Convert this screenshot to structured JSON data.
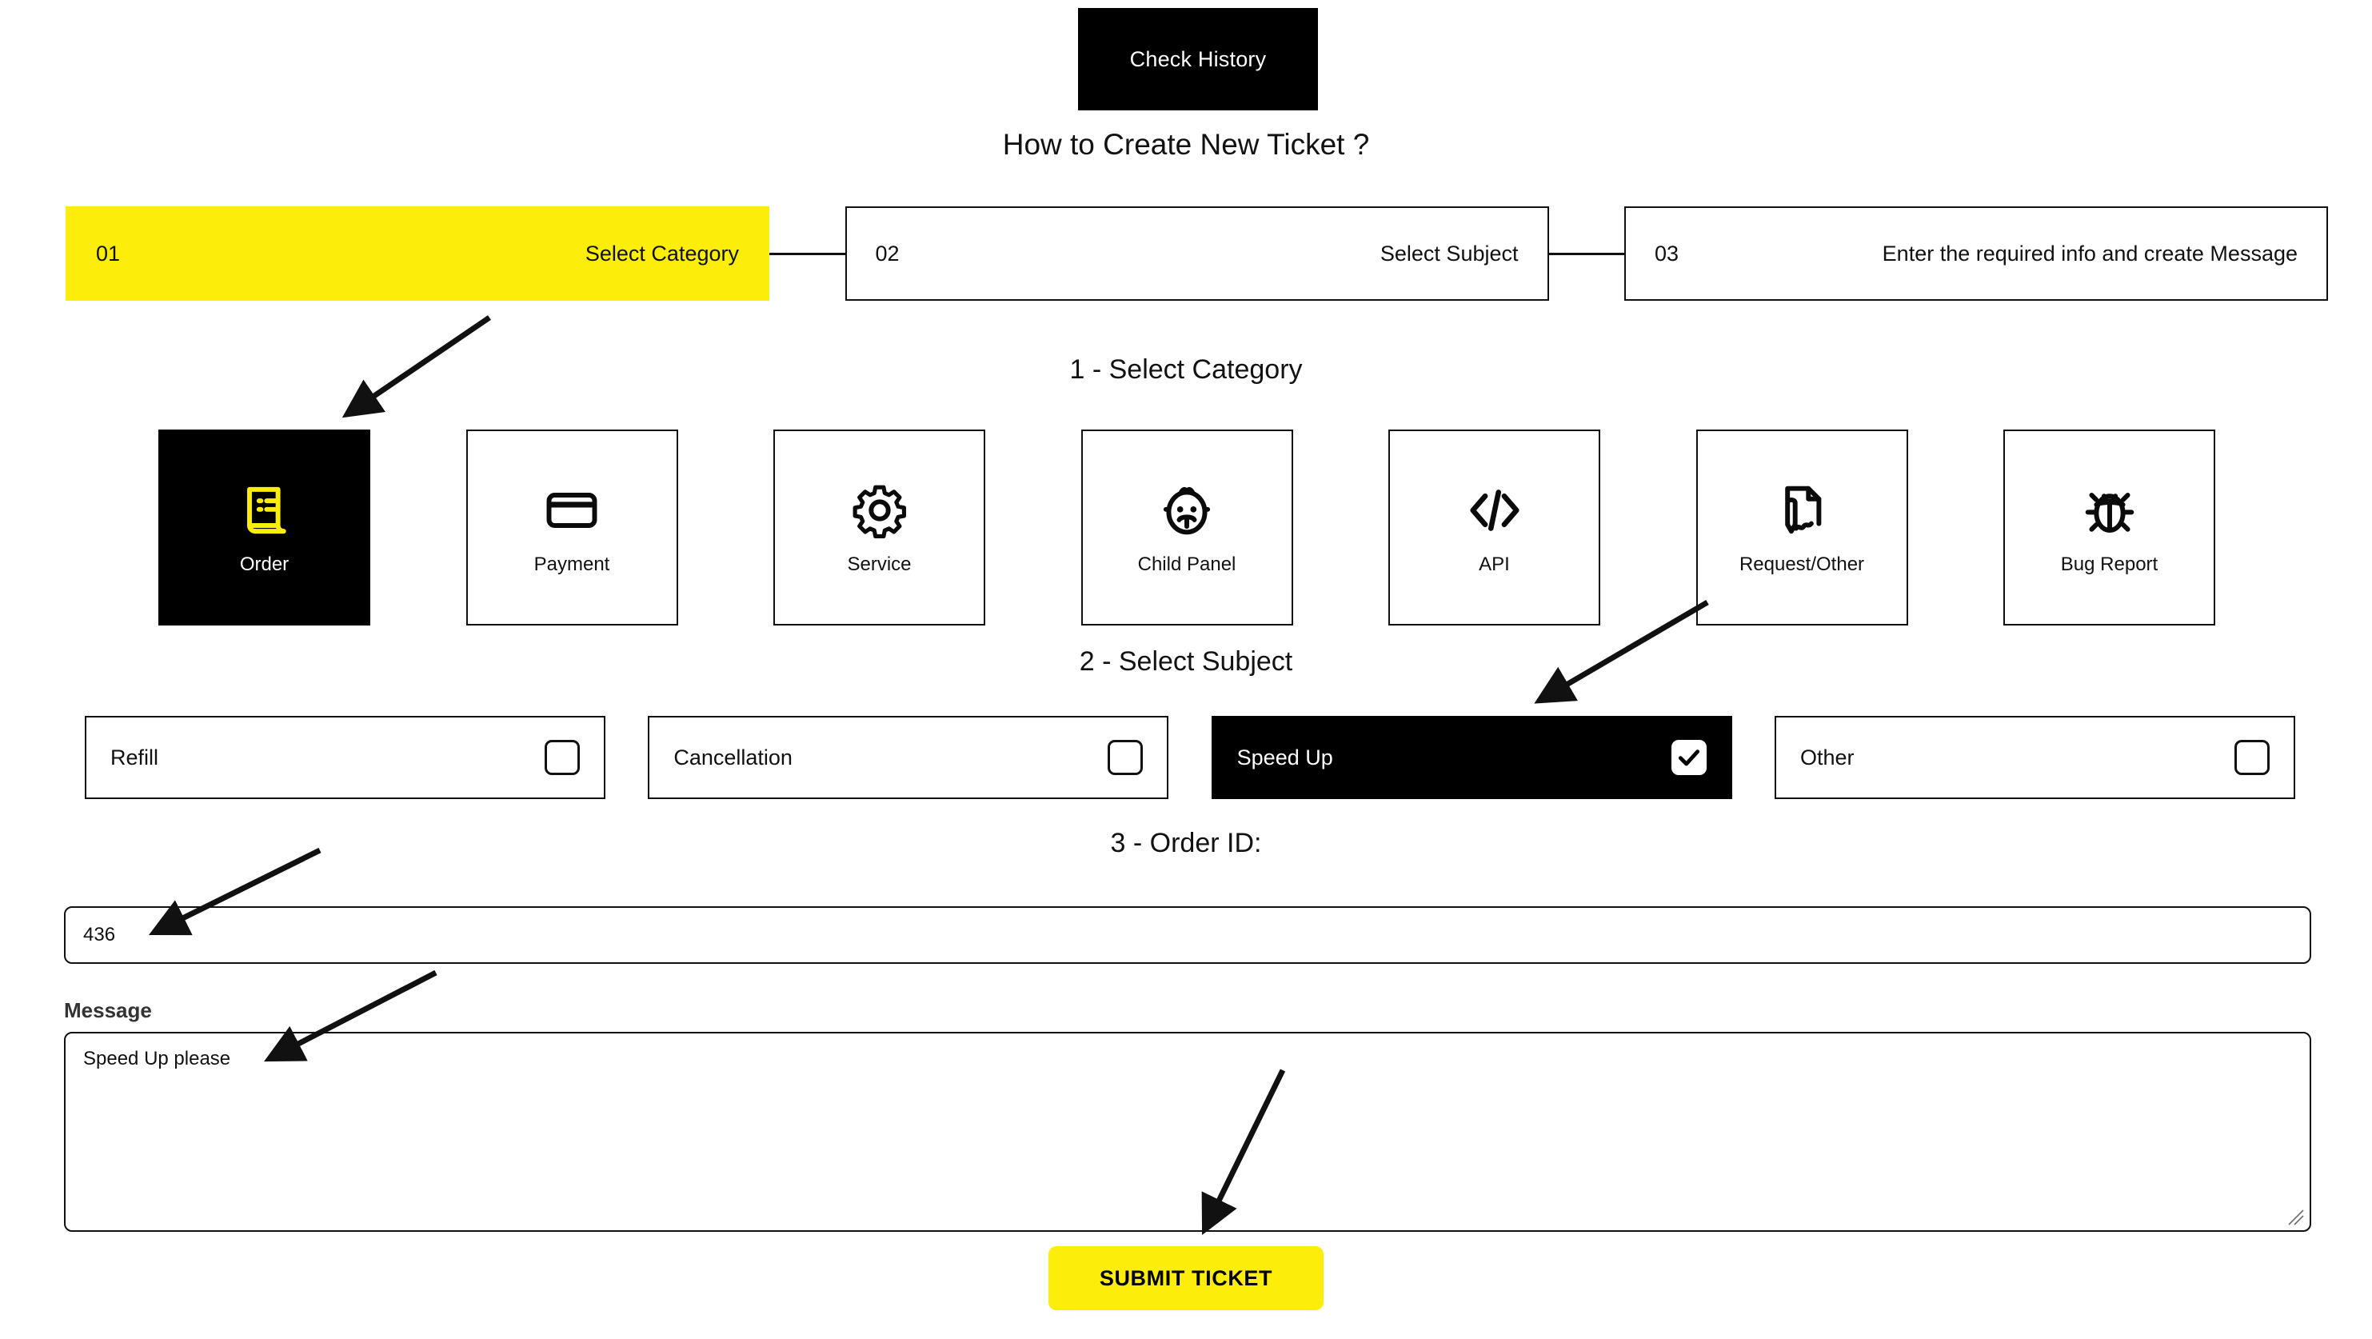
{
  "header": {
    "check_history_label": "Check History",
    "page_title": "How to Create New Ticket ?"
  },
  "steps": [
    {
      "number": "01",
      "label": "Select Category",
      "state": "active"
    },
    {
      "number": "02",
      "label": "Select Subject",
      "state": "idle"
    },
    {
      "number": "03",
      "label": "Enter the required info and create Message",
      "state": "idle"
    }
  ],
  "sections": {
    "category_heading": "1 - Select Category",
    "subject_heading": "2 - Select Subject",
    "order_id_heading": "3 - Order ID:"
  },
  "categories": [
    {
      "label": "Order",
      "icon": "receipt-icon",
      "selected": true
    },
    {
      "label": "Payment",
      "icon": "credit-card-icon",
      "selected": false
    },
    {
      "label": "Service",
      "icon": "gear-icon",
      "selected": false
    },
    {
      "label": "Child Panel",
      "icon": "baby-face-icon",
      "selected": false
    },
    {
      "label": "API",
      "icon": "code-brackets-icon",
      "selected": false
    },
    {
      "label": "Request/Other",
      "icon": "document-pen-icon",
      "selected": false
    },
    {
      "label": "Bug Report",
      "icon": "bug-icon",
      "selected": false
    }
  ],
  "subjects": [
    {
      "label": "Refill",
      "checked": false
    },
    {
      "label": "Cancellation",
      "checked": false
    },
    {
      "label": "Speed Up",
      "checked": true
    },
    {
      "label": "Other",
      "checked": false
    }
  ],
  "form": {
    "order_id_value": "436",
    "order_id_placeholder": "",
    "message_label": "Message",
    "message_value": "Speed Up please",
    "message_placeholder": "",
    "submit_label": "SUBMIT TICKET"
  },
  "colors": {
    "accent_yellow": "#FCEE0A",
    "selected_black": "#000000",
    "border_black": "#111111",
    "text_dark": "#121212",
    "page_background": "#FFFFFF"
  }
}
